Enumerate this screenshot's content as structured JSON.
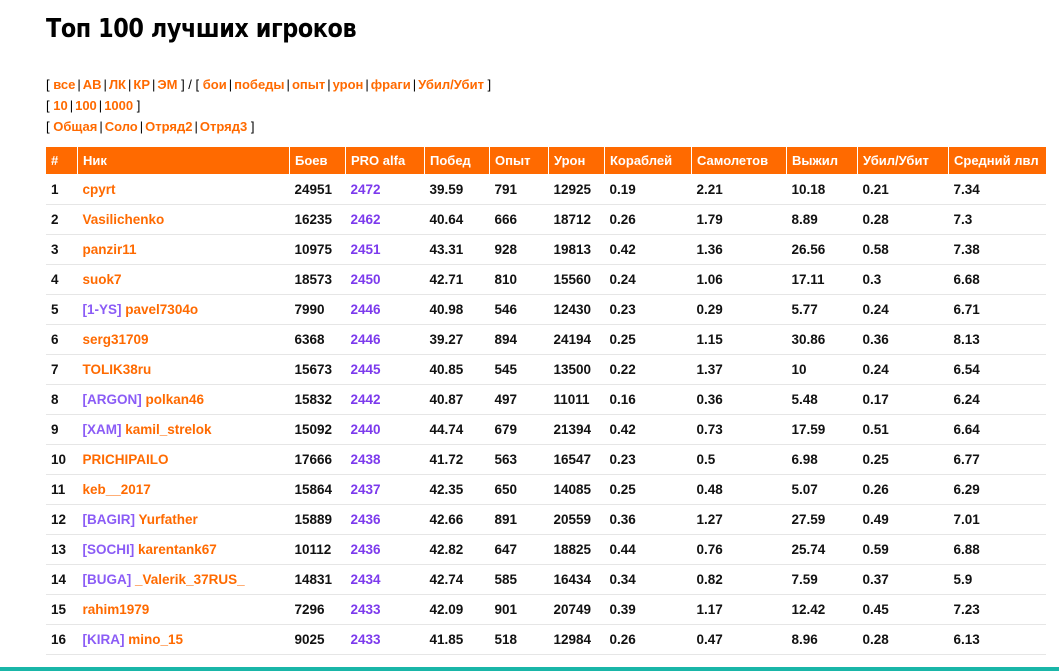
{
  "page": {
    "title": "Топ 100 лучших игроков"
  },
  "filters": {
    "types": [
      "все",
      "АВ",
      "ЛК",
      "КР",
      "ЭМ"
    ],
    "metrics": [
      "бои",
      "победы",
      "опыт",
      "урон",
      "фраги",
      "Убил/Убит"
    ],
    "counts": [
      "10",
      "100",
      "1000"
    ],
    "modes": [
      "Общая",
      "Соло",
      "Отряд2",
      "Отряд3"
    ]
  },
  "table": {
    "headers": [
      "#",
      "Ник",
      "Боев",
      "PRO alfa",
      "Побед",
      "Опыт",
      "Урон",
      "Кораблей",
      "Самолетов",
      "Выжил",
      "Убил/Убит",
      "Средний лвл"
    ],
    "rows": [
      {
        "n": "1",
        "clan": "",
        "nick": "cpyrt",
        "battles": "24951",
        "pro": "2472",
        "wins": "39.59",
        "exp": "791",
        "dmg": "12925",
        "ships": "0.19",
        "planes": "2.21",
        "surv": "10.18",
        "kd": "0.21",
        "lvl": "7.34"
      },
      {
        "n": "2",
        "clan": "",
        "nick": "Vasilichenko",
        "battles": "16235",
        "pro": "2462",
        "wins": "40.64",
        "exp": "666",
        "dmg": "18712",
        "ships": "0.26",
        "planes": "1.79",
        "surv": "8.89",
        "kd": "0.28",
        "lvl": "7.3"
      },
      {
        "n": "3",
        "clan": "",
        "nick": "panzir11",
        "battles": "10975",
        "pro": "2451",
        "wins": "43.31",
        "exp": "928",
        "dmg": "19813",
        "ships": "0.42",
        "planes": "1.36",
        "surv": "26.56",
        "kd": "0.58",
        "lvl": "7.38"
      },
      {
        "n": "4",
        "clan": "",
        "nick": "suok7",
        "battles": "18573",
        "pro": "2450",
        "wins": "42.71",
        "exp": "810",
        "dmg": "15560",
        "ships": "0.24",
        "planes": "1.06",
        "surv": "17.11",
        "kd": "0.3",
        "lvl": "6.68"
      },
      {
        "n": "5",
        "clan": "[1-YS]",
        "nick": "pavel7304o",
        "battles": "7990",
        "pro": "2446",
        "wins": "40.98",
        "exp": "546",
        "dmg": "12430",
        "ships": "0.23",
        "planes": "0.29",
        "surv": "5.77",
        "kd": "0.24",
        "lvl": "6.71"
      },
      {
        "n": "6",
        "clan": "",
        "nick": "serg31709",
        "battles": "6368",
        "pro": "2446",
        "wins": "39.27",
        "exp": "894",
        "dmg": "24194",
        "ships": "0.25",
        "planes": "1.15",
        "surv": "30.86",
        "kd": "0.36",
        "lvl": "8.13"
      },
      {
        "n": "7",
        "clan": "",
        "nick": "TOLIK38ru",
        "battles": "15673",
        "pro": "2445",
        "wins": "40.85",
        "exp": "545",
        "dmg": "13500",
        "ships": "0.22",
        "planes": "1.37",
        "surv": "10",
        "kd": "0.24",
        "lvl": "6.54"
      },
      {
        "n": "8",
        "clan": "[ARGON]",
        "nick": "polkan46",
        "battles": "15832",
        "pro": "2442",
        "wins": "40.87",
        "exp": "497",
        "dmg": "11011",
        "ships": "0.16",
        "planes": "0.36",
        "surv": "5.48",
        "kd": "0.17",
        "lvl": "6.24"
      },
      {
        "n": "9",
        "clan": "[XAM]",
        "nick": "kamil_strelok",
        "battles": "15092",
        "pro": "2440",
        "wins": "44.74",
        "exp": "679",
        "dmg": "21394",
        "ships": "0.42",
        "planes": "0.73",
        "surv": "17.59",
        "kd": "0.51",
        "lvl": "6.64"
      },
      {
        "n": "10",
        "clan": "",
        "nick": "PRICHIPAILO",
        "battles": "17666",
        "pro": "2438",
        "wins": "41.72",
        "exp": "563",
        "dmg": "16547",
        "ships": "0.23",
        "planes": "0.5",
        "surv": "6.98",
        "kd": "0.25",
        "lvl": "6.77"
      },
      {
        "n": "11",
        "clan": "",
        "nick": "keb__2017",
        "battles": "15864",
        "pro": "2437",
        "wins": "42.35",
        "exp": "650",
        "dmg": "14085",
        "ships": "0.25",
        "planes": "0.48",
        "surv": "5.07",
        "kd": "0.26",
        "lvl": "6.29"
      },
      {
        "n": "12",
        "clan": "[BAGIR]",
        "nick": "Yurfather",
        "battles": "15889",
        "pro": "2436",
        "wins": "42.66",
        "exp": "891",
        "dmg": "20559",
        "ships": "0.36",
        "planes": "1.27",
        "surv": "27.59",
        "kd": "0.49",
        "lvl": "7.01"
      },
      {
        "n": "13",
        "clan": "[SOCHI]",
        "nick": "karentank67",
        "battles": "10112",
        "pro": "2436",
        "wins": "42.82",
        "exp": "647",
        "dmg": "18825",
        "ships": "0.44",
        "planes": "0.76",
        "surv": "25.74",
        "kd": "0.59",
        "lvl": "6.88"
      },
      {
        "n": "14",
        "clan": "[BUGA]",
        "nick": "_Valerik_37RUS_",
        "battles": "14831",
        "pro": "2434",
        "wins": "42.74",
        "exp": "585",
        "dmg": "16434",
        "ships": "0.34",
        "planes": "0.82",
        "surv": "7.59",
        "kd": "0.37",
        "lvl": "5.9"
      },
      {
        "n": "15",
        "clan": "",
        "nick": "rahim1979",
        "battles": "7296",
        "pro": "2433",
        "wins": "42.09",
        "exp": "901",
        "dmg": "20749",
        "ships": "0.39",
        "planes": "1.17",
        "surv": "12.42",
        "kd": "0.45",
        "lvl": "7.23"
      },
      {
        "n": "16",
        "clan": "[KIRA]",
        "nick": "mino_15",
        "battles": "9025",
        "pro": "2433",
        "wins": "41.85",
        "exp": "518",
        "dmg": "12984",
        "ships": "0.26",
        "planes": "0.47",
        "surv": "8.96",
        "kd": "0.28",
        "lvl": "6.13"
      }
    ]
  }
}
